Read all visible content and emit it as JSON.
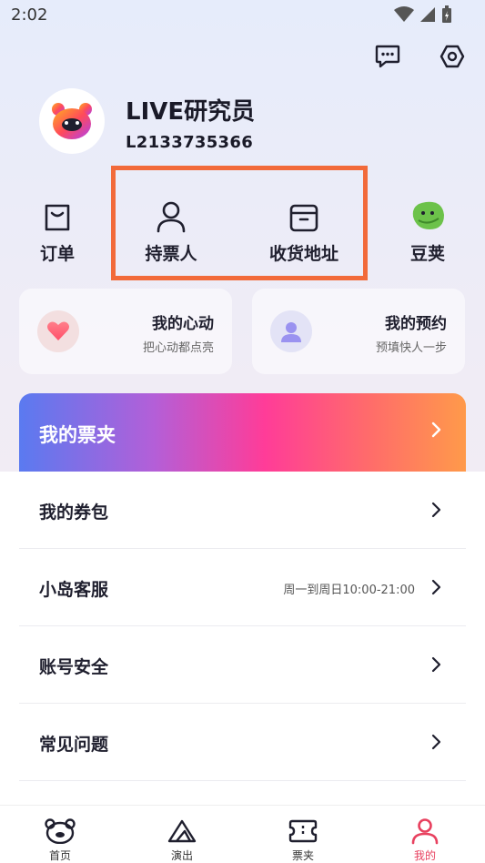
{
  "status_bar": {
    "time": "2:02"
  },
  "header": {
    "message_icon": "message-icon",
    "settings_icon": "settings-icon"
  },
  "profile": {
    "name": "LIVE研究员",
    "id": "L2133735366"
  },
  "quick_actions": [
    {
      "label": "订单",
      "icon": "bag-icon"
    },
    {
      "label": "持票人",
      "icon": "person-icon"
    },
    {
      "label": "收货地址",
      "icon": "box-icon"
    },
    {
      "label": "豆荚",
      "icon": "bean-icon"
    }
  ],
  "cards": [
    {
      "title": "我的心动",
      "subtitle": "把心动都点亮",
      "icon": "heart-icon"
    },
    {
      "title": "我的预约",
      "subtitle": "预填快人一步",
      "icon": "user-circle-icon"
    }
  ],
  "ticket_banner": {
    "title": "我的票夹"
  },
  "menu": [
    {
      "label": "我的券包",
      "value": ""
    },
    {
      "label": "小岛客服",
      "value": "周一到周日10:00-21:00"
    },
    {
      "label": "账号安全",
      "value": ""
    },
    {
      "label": "常见问题",
      "value": ""
    }
  ],
  "bottom_nav": [
    {
      "label": "首页",
      "icon": "bear-icon",
      "active": false
    },
    {
      "label": "演出",
      "icon": "mountain-icon",
      "active": false
    },
    {
      "label": "票夹",
      "icon": "ticket-icon",
      "active": false
    },
    {
      "label": "我的",
      "icon": "profile-icon",
      "active": true
    }
  ],
  "colors": {
    "accent": "#e8415f",
    "highlight_border": "#f26a3a"
  }
}
